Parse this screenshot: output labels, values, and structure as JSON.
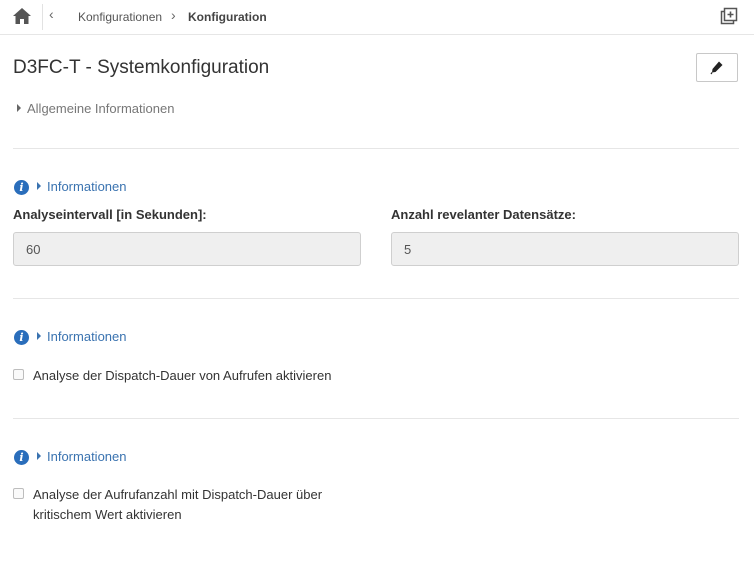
{
  "header": {
    "home_icon": "home-icon",
    "back_glyph": "‹",
    "breadcrumb": [
      "Konfigurationen",
      "Konfiguration"
    ],
    "breadcrumb_sep": "›",
    "new_window_icon": "new-window-icon"
  },
  "main": {
    "title": "D3FC-T - Systemkonfiguration",
    "edit_icon": "pencil-icon",
    "general_info_label": "Allgemeine Informationen",
    "sections": [
      {
        "info_label": "Informationen",
        "fields": [
          {
            "label": "Analyseintervall [in Sekunden]:",
            "value": "60"
          },
          {
            "label": "Anzahl revelanter Datensätze:",
            "value": "5"
          }
        ]
      },
      {
        "info_label": "Informationen",
        "checkbox_label": "Analyse der Dispatch-Dauer von Aufrufen aktivieren",
        "checked": false
      },
      {
        "info_label": "Informationen",
        "checkbox_label": "Analyse der Aufrufanzahl mit Dispatch-Dauer über kritischem Wert aktivieren",
        "checked": false
      }
    ]
  },
  "colors": {
    "accent": "#3a73b0",
    "info_icon": "#2a6ebb",
    "field_bg": "#efefef",
    "divider": "#e6e6e6"
  }
}
